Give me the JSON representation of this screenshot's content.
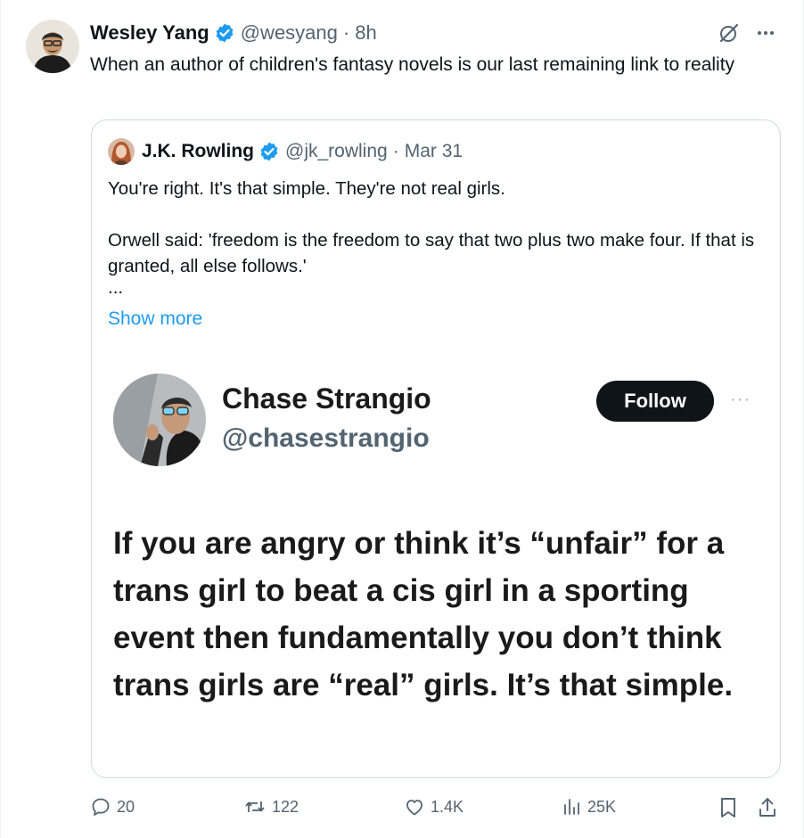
{
  "tweet": {
    "author_name": "Wesley Yang",
    "handle": "@wesyang",
    "separator": "·",
    "time": "8h",
    "text": "When an author of children's fantasy novels is our last remaining link to reality"
  },
  "quote": {
    "author_name": "J.K. Rowling",
    "handle": "@jk_rowling",
    "separator": "·",
    "date": "Mar 31",
    "line1": "You're right. It's that simple. They're not real girls.",
    "line2": "Orwell said: 'freedom is the freedom to say that two plus two make four. If that is granted, all else follows.'",
    "ellipsis": "...",
    "show_more": "Show more"
  },
  "embed": {
    "name": "Chase Strangio",
    "handle": "@chasestrangio",
    "follow_label": "Follow",
    "more": "···",
    "text": "If you are angry or think it’s “unfair” for a trans girl to beat a cis girl in a sporting event then fundamentally you don’t think trans girls are “real” girls. It’s that simple."
  },
  "actions": {
    "replies": "20",
    "reposts": "122",
    "likes": "1.4K",
    "views": "25K"
  },
  "colors": {
    "verified": "#1d9bf0",
    "link": "#1d9bf0",
    "muted": "#536471",
    "border": "#cfd9de"
  },
  "icons": [
    "verified-badge-icon",
    "grok-icon",
    "more-icon",
    "reply-icon",
    "repost-icon",
    "like-icon",
    "views-icon",
    "bookmark-icon",
    "share-icon"
  ]
}
